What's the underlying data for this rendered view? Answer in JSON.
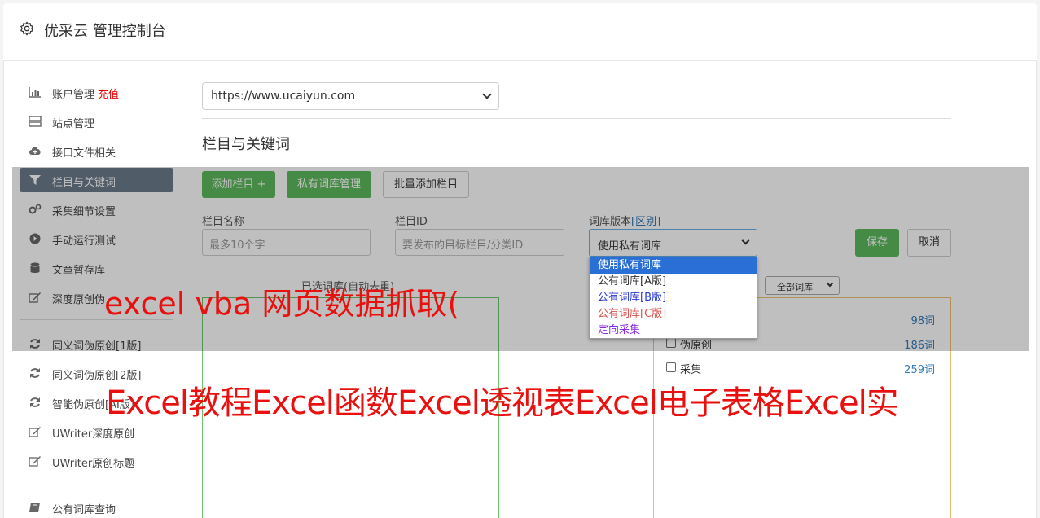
{
  "header": {
    "title": "优采云 管理控制台",
    "icon": "gear-icon"
  },
  "sidebar": {
    "items": [
      {
        "label": "账户管理",
        "icon": "bar-chart-icon",
        "badge": "充值"
      },
      {
        "label": "站点管理",
        "icon": "server-icon"
      },
      {
        "label": "接口文件相关",
        "icon": "cloud-upload-icon"
      },
      {
        "label": "栏目与关键词",
        "icon": "filter-icon",
        "active": true
      },
      {
        "label": "采集细节设置",
        "icon": "gears-icon"
      },
      {
        "label": "手动运行测试",
        "icon": "play-circle-icon"
      },
      {
        "label": "文章暂存库",
        "icon": "database-icon"
      },
      {
        "label": "深度原创伪",
        "icon": "edit-icon"
      },
      {
        "label": "同义词伪原创[1版]",
        "icon": "refresh-icon"
      },
      {
        "label": "同义词伪原创[2版]",
        "icon": "refresh-icon"
      },
      {
        "label": "智能伪原创[AI版]",
        "icon": "refresh-icon"
      },
      {
        "label": "UWriter深度原创",
        "icon": "edit-icon"
      },
      {
        "label": "UWriter原创标题",
        "icon": "edit-icon"
      },
      {
        "label": "公有词库查询",
        "icon": "book-icon"
      }
    ]
  },
  "site_select": {
    "value": "https://www.ucaiyun.com"
  },
  "section_title": "栏目与关键词",
  "toolbar": {
    "add_column": "添加栏目 +",
    "private_lib": "私有词库管理",
    "batch_add": "批量添加栏目"
  },
  "form": {
    "name_label": "栏目名称",
    "name_placeholder": "最多10个字",
    "id_label": "栏目ID",
    "id_placeholder": "要发布的目标栏目/分类ID",
    "version_label": "词库版本",
    "version_link": "[区别]",
    "version_value": "使用私有词库",
    "save": "保存",
    "cancel": "取消"
  },
  "dropdown": {
    "options": [
      {
        "label": "使用私有词库",
        "color": "#ffffff",
        "selected": true
      },
      {
        "label": "公有词库[A版]",
        "color": "#333333"
      },
      {
        "label": "公有词库[B版]",
        "color": "#2b3bd6"
      },
      {
        "label": "公有词库[C版]",
        "color": "#d9534f"
      },
      {
        "label": "定向采集",
        "color": "#8a2be2"
      }
    ]
  },
  "selected_lib_label": "已选词库(自动去重)",
  "lib_filter": {
    "value": "全部词库"
  },
  "library_list": [
    {
      "name": "",
      "count": "98词"
    },
    {
      "name": "伪原创",
      "count": "186词"
    },
    {
      "name": "采集",
      "count": "259词"
    }
  ],
  "watermark": {
    "line1": "excel vba 网页数据抓取(",
    "line2": "Excel教程Excel函数Excel透视表Excel电子表格Excel实"
  }
}
